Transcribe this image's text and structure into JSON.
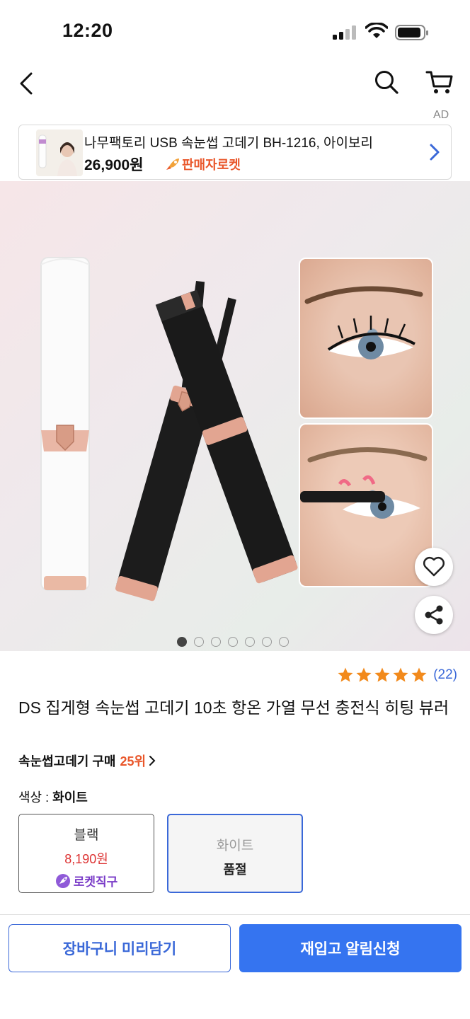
{
  "status_bar": {
    "time": "12:20"
  },
  "nav": {
    "back_icon": "chevron-left-icon",
    "search_icon": "search-icon",
    "cart_icon": "cart-icon"
  },
  "ad": {
    "label": "AD",
    "title": "나무팩토리 USB 속눈썹 고데기 BH-1216, 아이보리",
    "price": "26,900원",
    "badge": "판매자로켓"
  },
  "gallery": {
    "total": 7,
    "active": 0
  },
  "product": {
    "rating_count": "(22)",
    "stars": 5,
    "title": "DS 집게형 속눈썹 고데기 10초 항온 가열 무선 충전식 히팅 뷰러",
    "rank_text": "속눈썹고데기 구매",
    "rank_num": "25위"
  },
  "options": {
    "label_key": "색상 :",
    "label_value": "화이트",
    "black": {
      "name": "블랙",
      "price": "8,190원",
      "badge": "로켓직구"
    },
    "white": {
      "name": "화이트",
      "status": "품절"
    }
  },
  "buttons": {
    "cart": "장바구니 미리담기",
    "notify": "재입고 알림신청"
  },
  "colors": {
    "accent": "#3574f0",
    "rank": "#e9572b",
    "star": "#f28a1c"
  }
}
